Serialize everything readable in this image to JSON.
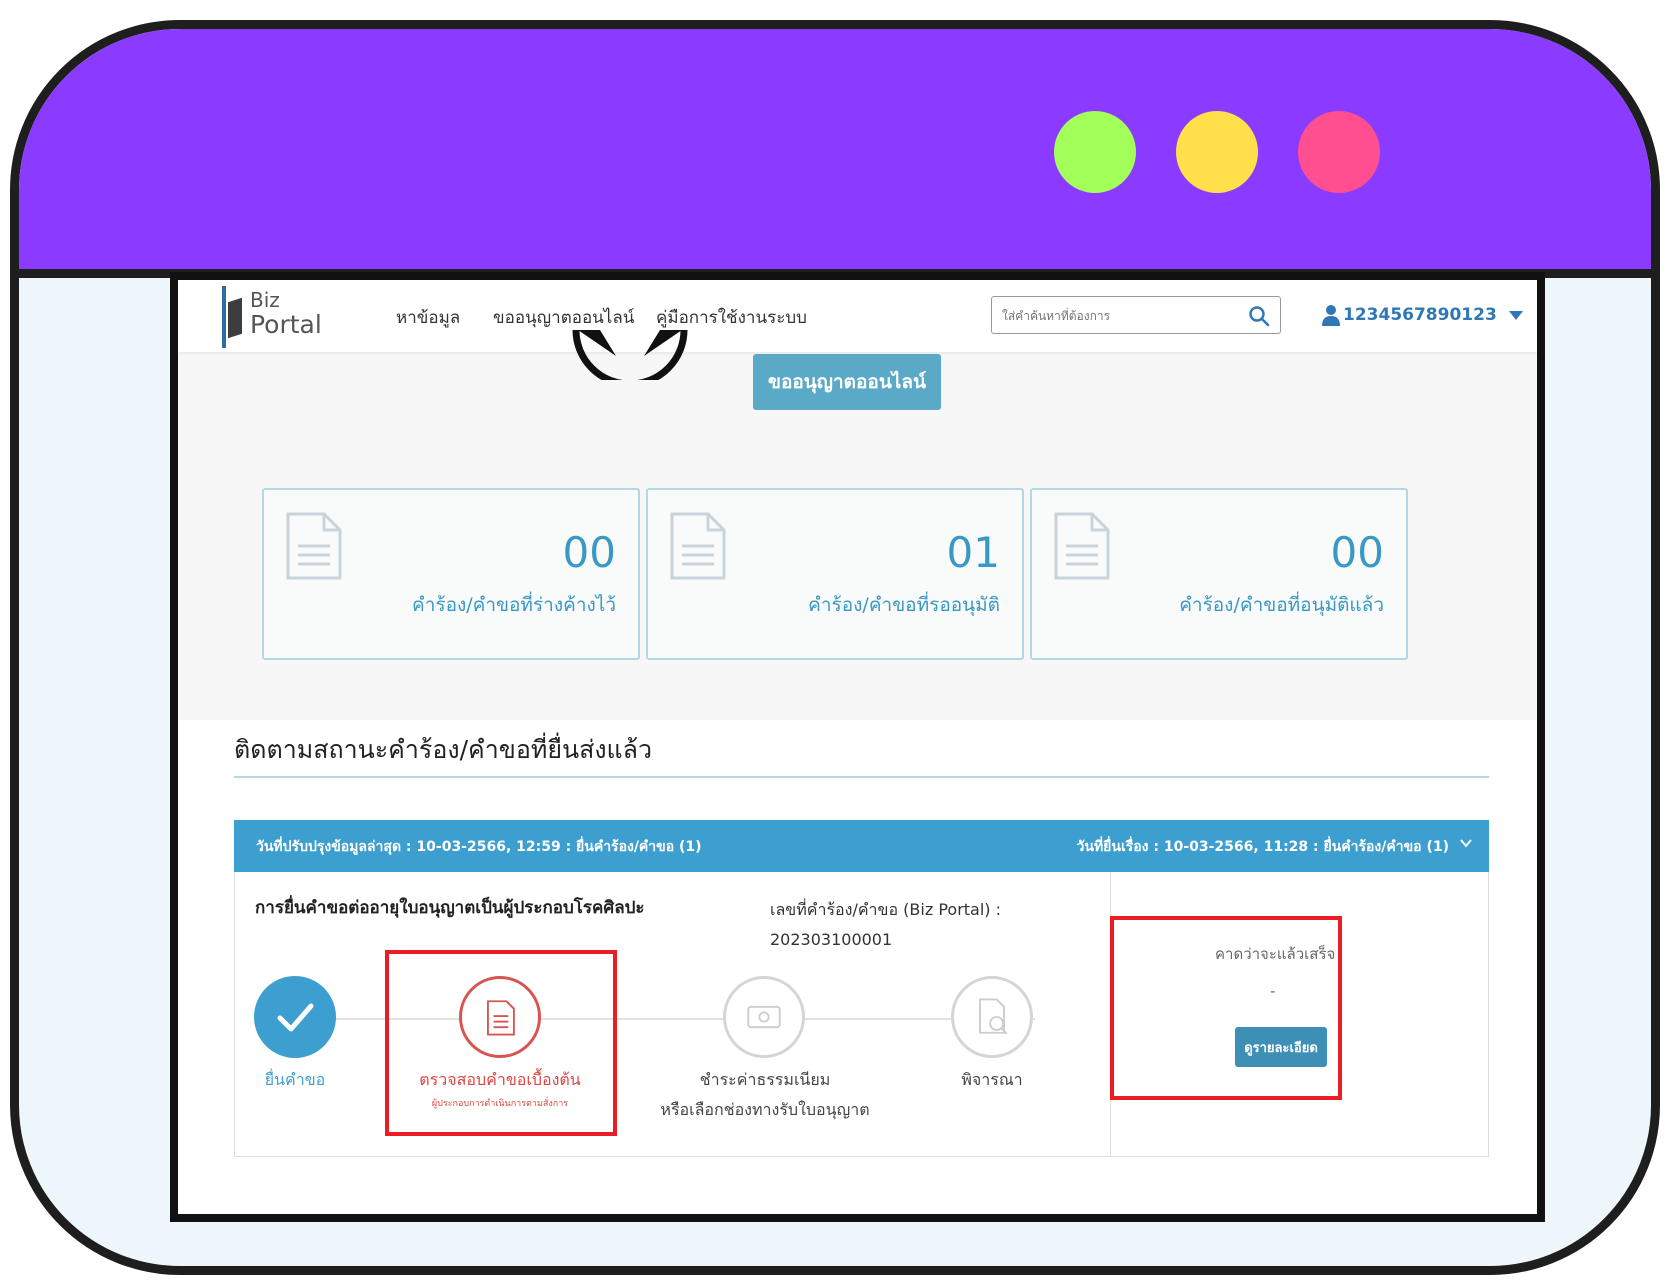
{
  "window": {
    "colors": {
      "titlebar": "#8b3bff",
      "dot_green": "#a3ff5a",
      "dot_yellow": "#ffe04a",
      "dot_pink": "#ff4f91"
    }
  },
  "nav": {
    "logo_biz": "Biz",
    "logo_portal": "Portal",
    "links": [
      "หาข้อมูล",
      "ขออนุญาตออนไลน์",
      "คู่มือการใช้งานระบบ"
    ],
    "search_placeholder": "ใส่คำค้นหาที่ต้องการ",
    "user_id": "1234567890123"
  },
  "hero": {
    "button_label": "ขออนุญาตออนไลน์"
  },
  "stats": [
    {
      "count": "00",
      "label": "คำร้อง/คำขอที่ร่างค้างไว้"
    },
    {
      "count": "01",
      "label": "คำร้อง/คำขอที่รออนุมัติ"
    },
    {
      "count": "00",
      "label": "คำร้อง/คำขอที่อนุมัติแล้ว"
    }
  ],
  "tracking": {
    "title": "ติดตามสถานะคำร้อง/คำขอที่ยื่นส่งแล้ว",
    "band_left": "วันที่ปรับปรุงข้อมูลล่าสุด : 10-03-2566, 12:59 : ยื่นคำร้อง/คำขอ (1)",
    "band_right": "วันที่ยื่นเรื่อง : 10-03-2566, 11:28 : ยื่นคำร้อง/คำขอ (1)",
    "request_title": "การยื่นคำขอต่ออายุใบอนุญาตเป็นผู้ประกอบโรคศิลปะ",
    "request_no_label": "เลขที่คำร้อง/คำขอ (Biz Portal) :",
    "request_no": "202303100001",
    "steps": [
      {
        "label": "ยื่นคำขอ",
        "sub": "",
        "state": "done"
      },
      {
        "label": "ตรวจสอบคำขอเบื้องต้น",
        "sub": "ผู้ประกอบการดำเนินการตามสั่งการ",
        "state": "current"
      },
      {
        "label": "ชำระค่าธรรมเนียม",
        "sub": "หรือเลือกช่องทางรับใบอนุญาต",
        "state": "pending"
      },
      {
        "label": "พิจารณา",
        "sub": "",
        "state": "pending"
      }
    ],
    "eta_label": "คาดว่าจะแล้วเสร็จ",
    "eta_value": "-",
    "detail_button": "ดูรายละเอียด"
  }
}
